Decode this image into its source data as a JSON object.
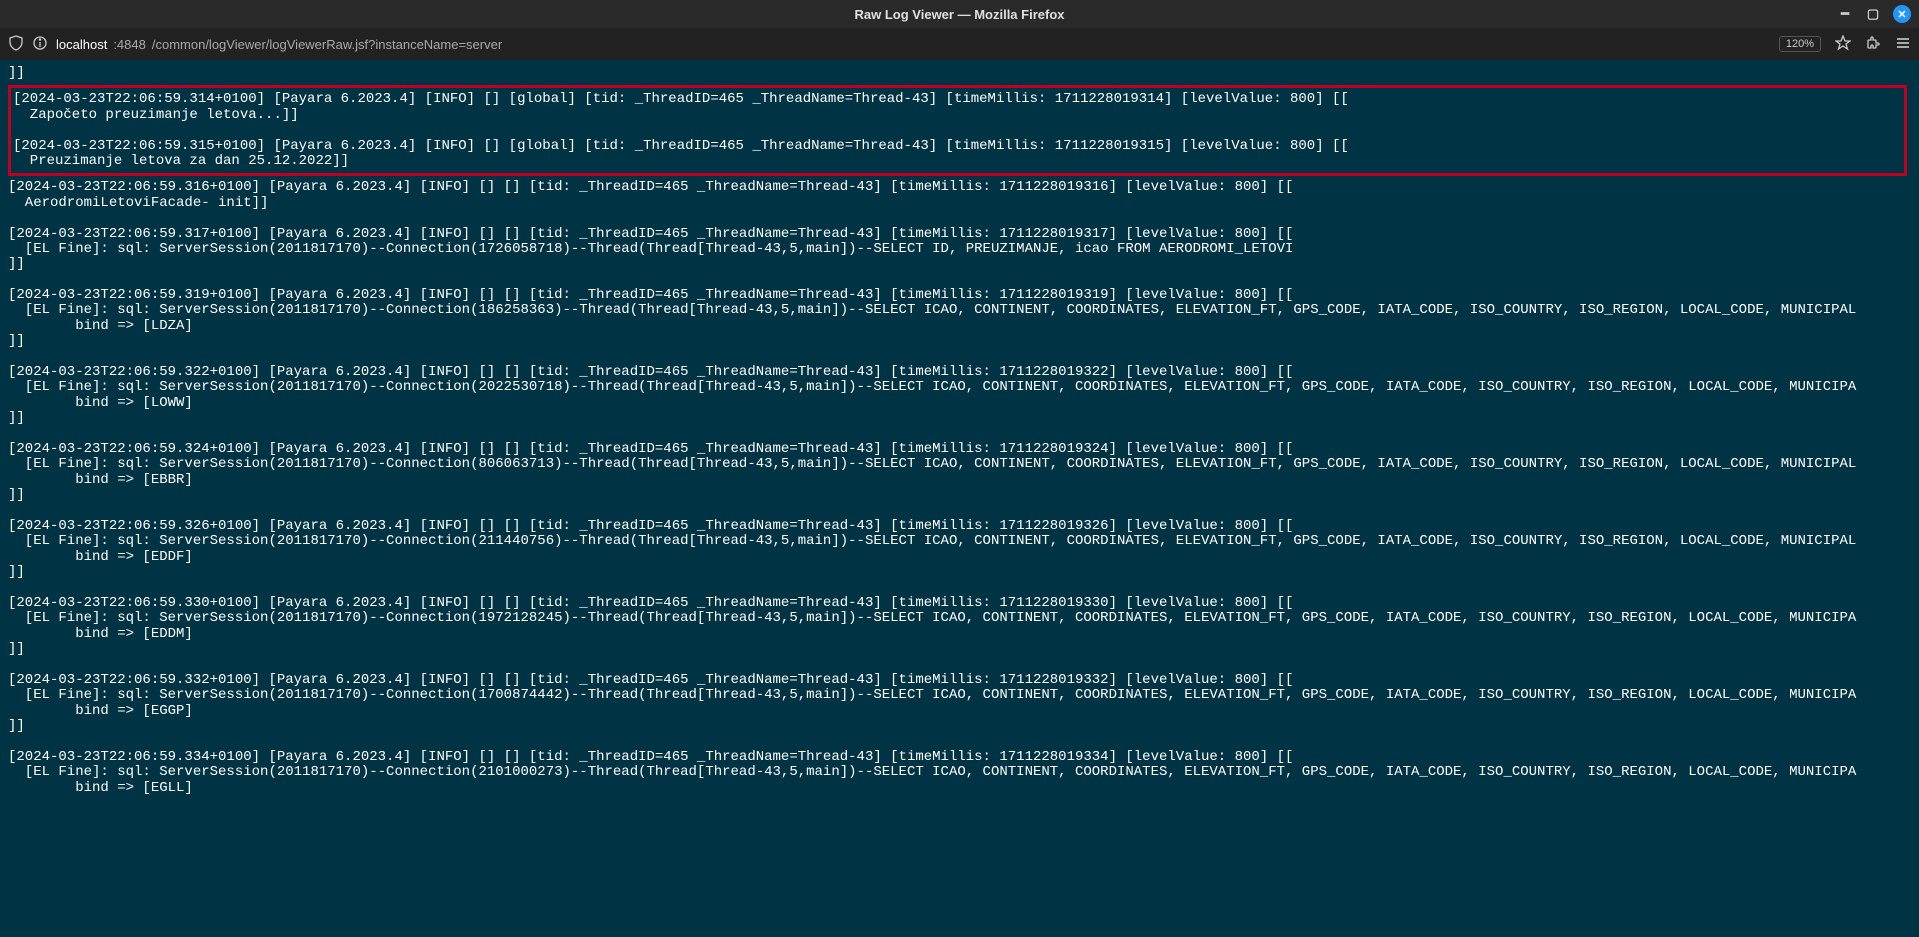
{
  "window": {
    "title": "Raw Log Viewer — Mozilla Firefox"
  },
  "toolbar": {
    "url_host": "localhost",
    "url_port": ":4848",
    "url_path": "/common/logViewer/logViewerRaw.jsf?instanceName=server",
    "zoom": "120%"
  },
  "log": {
    "line0": "]]",
    "highlighted": "[2024-03-23T22:06:59.314+0100] [Payara 6.2023.4] [INFO] [] [global] [tid: _ThreadID=465 _ThreadName=Thread-43] [timeMillis: 1711228019314] [levelValue: 800] [[\n  Započeto preuzimanje letova...]]\n\n[2024-03-23T22:06:59.315+0100] [Payara 6.2023.4] [INFO] [] [global] [tid: _ThreadID=465 _ThreadName=Thread-43] [timeMillis: 1711228019315] [levelValue: 800] [[\n  Preuzimanje letova za dan 25.12.2022]]",
    "rest": "[2024-03-23T22:06:59.316+0100] [Payara 6.2023.4] [INFO] [] [] [tid: _ThreadID=465 _ThreadName=Thread-43] [timeMillis: 1711228019316] [levelValue: 800] [[\n  AerodromiLetoviFacade- init]]\n\n[2024-03-23T22:06:59.317+0100] [Payara 6.2023.4] [INFO] [] [] [tid: _ThreadID=465 _ThreadName=Thread-43] [timeMillis: 1711228019317] [levelValue: 800] [[\n  [EL Fine]: sql: ServerSession(2011817170)--Connection(1726058718)--Thread(Thread[Thread-43,5,main])--SELECT ID, PREUZIMANJE, icao FROM AERODROMI_LETOVI\n]]\n\n[2024-03-23T22:06:59.319+0100] [Payara 6.2023.4] [INFO] [] [] [tid: _ThreadID=465 _ThreadName=Thread-43] [timeMillis: 1711228019319] [levelValue: 800] [[\n  [EL Fine]: sql: ServerSession(2011817170)--Connection(186258363)--Thread(Thread[Thread-43,5,main])--SELECT ICAO, CONTINENT, COORDINATES, ELEVATION_FT, GPS_CODE, IATA_CODE, ISO_COUNTRY, ISO_REGION, LOCAL_CODE, MUNICIPAL\n        bind => [LDZA]\n]]\n\n[2024-03-23T22:06:59.322+0100] [Payara 6.2023.4] [INFO] [] [] [tid: _ThreadID=465 _ThreadName=Thread-43] [timeMillis: 1711228019322] [levelValue: 800] [[\n  [EL Fine]: sql: ServerSession(2011817170)--Connection(2022530718)--Thread(Thread[Thread-43,5,main])--SELECT ICAO, CONTINENT, COORDINATES, ELEVATION_FT, GPS_CODE, IATA_CODE, ISO_COUNTRY, ISO_REGION, LOCAL_CODE, MUNICIPA\n        bind => [LOWW]\n]]\n\n[2024-03-23T22:06:59.324+0100] [Payara 6.2023.4] [INFO] [] [] [tid: _ThreadID=465 _ThreadName=Thread-43] [timeMillis: 1711228019324] [levelValue: 800] [[\n  [EL Fine]: sql: ServerSession(2011817170)--Connection(806063713)--Thread(Thread[Thread-43,5,main])--SELECT ICAO, CONTINENT, COORDINATES, ELEVATION_FT, GPS_CODE, IATA_CODE, ISO_COUNTRY, ISO_REGION, LOCAL_CODE, MUNICIPAL\n        bind => [EBBR]\n]]\n\n[2024-03-23T22:06:59.326+0100] [Payara 6.2023.4] [INFO] [] [] [tid: _ThreadID=465 _ThreadName=Thread-43] [timeMillis: 1711228019326] [levelValue: 800] [[\n  [EL Fine]: sql: ServerSession(2011817170)--Connection(211440756)--Thread(Thread[Thread-43,5,main])--SELECT ICAO, CONTINENT, COORDINATES, ELEVATION_FT, GPS_CODE, IATA_CODE, ISO_COUNTRY, ISO_REGION, LOCAL_CODE, MUNICIPAL\n        bind => [EDDF]\n]]\n\n[2024-03-23T22:06:59.330+0100] [Payara 6.2023.4] [INFO] [] [] [tid: _ThreadID=465 _ThreadName=Thread-43] [timeMillis: 1711228019330] [levelValue: 800] [[\n  [EL Fine]: sql: ServerSession(2011817170)--Connection(1972128245)--Thread(Thread[Thread-43,5,main])--SELECT ICAO, CONTINENT, COORDINATES, ELEVATION_FT, GPS_CODE, IATA_CODE, ISO_COUNTRY, ISO_REGION, LOCAL_CODE, MUNICIPA\n        bind => [EDDM]\n]]\n\n[2024-03-23T22:06:59.332+0100] [Payara 6.2023.4] [INFO] [] [] [tid: _ThreadID=465 _ThreadName=Thread-43] [timeMillis: 1711228019332] [levelValue: 800] [[\n  [EL Fine]: sql: ServerSession(2011817170)--Connection(1700874442)--Thread(Thread[Thread-43,5,main])--SELECT ICAO, CONTINENT, COORDINATES, ELEVATION_FT, GPS_CODE, IATA_CODE, ISO_COUNTRY, ISO_REGION, LOCAL_CODE, MUNICIPA\n        bind => [EGGP]\n]]\n\n[2024-03-23T22:06:59.334+0100] [Payara 6.2023.4] [INFO] [] [] [tid: _ThreadID=465 _ThreadName=Thread-43] [timeMillis: 1711228019334] [levelValue: 800] [[\n  [EL Fine]: sql: ServerSession(2011817170)--Connection(2101000273)--Thread(Thread[Thread-43,5,main])--SELECT ICAO, CONTINENT, COORDINATES, ELEVATION_FT, GPS_CODE, IATA_CODE, ISO_COUNTRY, ISO_REGION, LOCAL_CODE, MUNICIPA\n        bind => [EGLL]"
  }
}
